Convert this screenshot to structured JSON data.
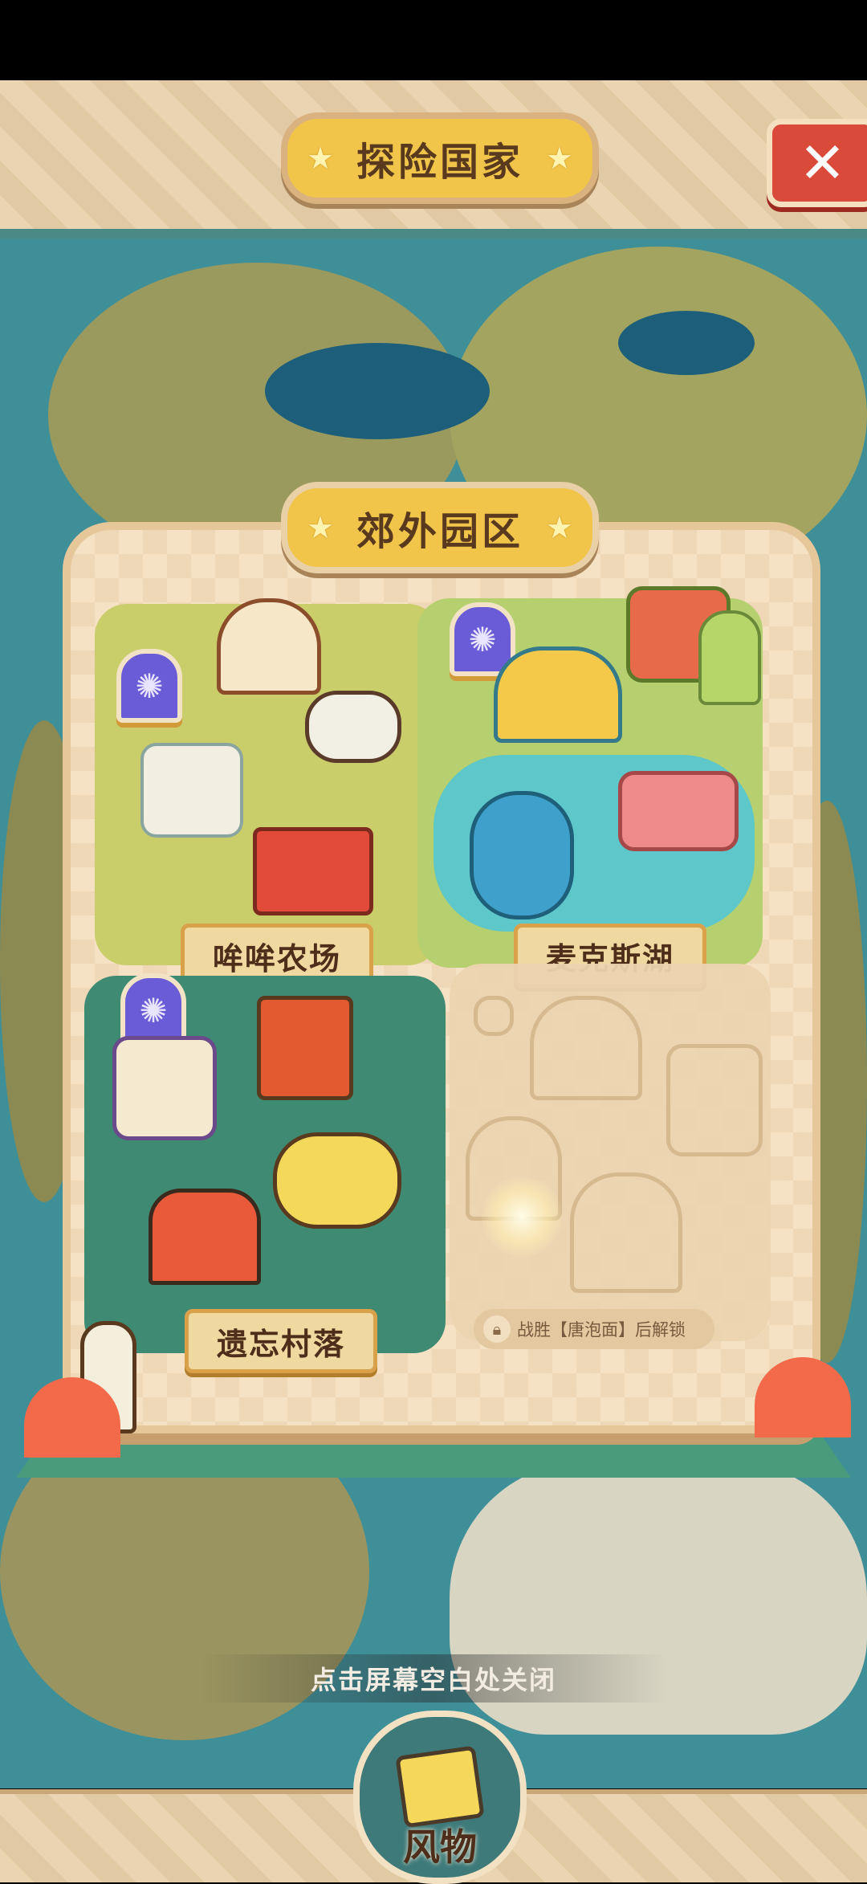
{
  "header": {
    "title": "探险国家",
    "close_icon": "close-icon"
  },
  "region": {
    "title": "郊外园区"
  },
  "zones": [
    {
      "name": "哞哞农场"
    },
    {
      "name": "麦克斯湖"
    },
    {
      "name": "遗忘村落"
    }
  ],
  "locked_zone": {
    "unlock_text": "战胜【唐泡面】后解锁"
  },
  "hint": {
    "text": "点击屏幕空白处关闭"
  },
  "bottom": {
    "relic_label": "风物"
  },
  "colors": {
    "accent": "#f1c54a",
    "frame": "#f5e1c3",
    "close": "#d94a3a",
    "sea": "#3f8f99"
  }
}
